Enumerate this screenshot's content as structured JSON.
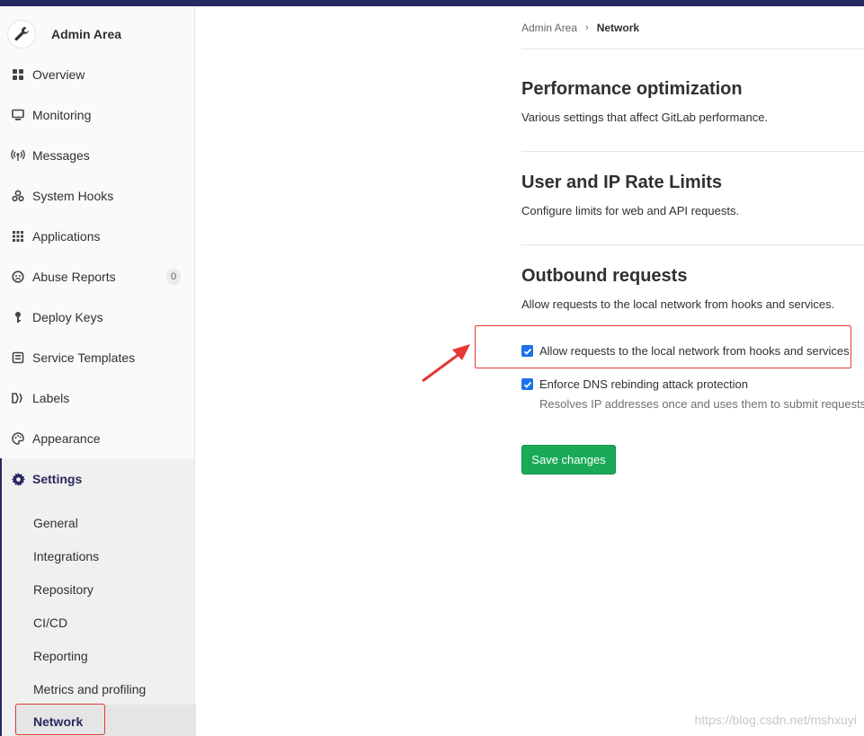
{
  "sidebar": {
    "title": "Admin Area",
    "items": [
      {
        "label": "Overview",
        "icon": "overview-grid-icon"
      },
      {
        "label": "Monitoring",
        "icon": "monitor-icon"
      },
      {
        "label": "Messages",
        "icon": "broadcast-icon"
      },
      {
        "label": "System Hooks",
        "icon": "hook-icon"
      },
      {
        "label": "Applications",
        "icon": "apps-grid-icon"
      },
      {
        "label": "Abuse Reports",
        "icon": "abuse-face-icon",
        "badge": "0"
      },
      {
        "label": "Deploy Keys",
        "icon": "key-icon"
      },
      {
        "label": "Service Templates",
        "icon": "template-icon"
      },
      {
        "label": "Labels",
        "icon": "labels-icon"
      },
      {
        "label": "Appearance",
        "icon": "palette-icon"
      }
    ],
    "settings": {
      "label": "Settings",
      "icon": "gear-icon",
      "sub_items": [
        "General",
        "Integrations",
        "Repository",
        "CI/CD",
        "Reporting",
        "Metrics and profiling",
        "Network"
      ]
    }
  },
  "breadcrumb": {
    "root": "Admin Area",
    "current": "Network"
  },
  "sections": [
    {
      "title": "Performance optimization",
      "desc": "Various settings that affect GitLab performance."
    },
    {
      "title": "User and IP Rate Limits",
      "desc": "Configure limits for web and API requests."
    },
    {
      "title": "Outbound requests",
      "desc": "Allow requests to the local network from hooks and services."
    }
  ],
  "outbound": {
    "allow_local_label": "Allow requests to the local network from hooks and services",
    "allow_local_checked": true,
    "dns_label": "Enforce DNS rebinding attack protection",
    "dns_checked": true,
    "dns_help": "Resolves IP addresses once and uses them to submit requests"
  },
  "save_label": "Save changes",
  "watermark": "https://blog.csdn.net/mshxuyi",
  "colors": {
    "topbar": "#292961",
    "save_button": "#1aaa55",
    "checkbox": "#1a73e8",
    "annotation": "#e53935"
  }
}
